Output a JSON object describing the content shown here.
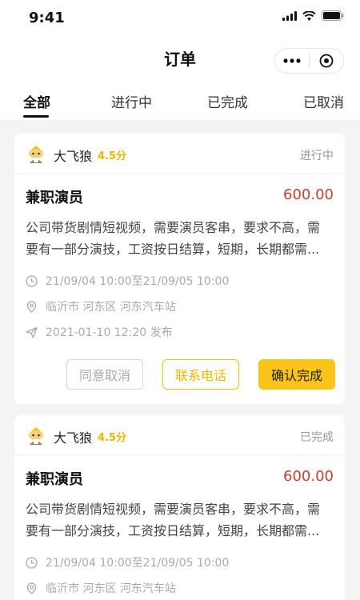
{
  "status_bar": {
    "time": "9:41"
  },
  "nav": {
    "title": "订单"
  },
  "tabs": [
    {
      "label": "全部",
      "active": true
    },
    {
      "label": "进行中",
      "active": false
    },
    {
      "label": "已完成",
      "active": false
    },
    {
      "label": "已取消",
      "active": false
    }
  ],
  "orders": [
    {
      "user": "大飞狼",
      "rating": "4.5分",
      "status": "进行中",
      "title": "兼职演员",
      "price": "600.00",
      "desc_line1": "公司带货剧情短视频，需要演员客串，要求不高，需",
      "desc_line2": "要有一部分演技，工资按日结算，短期，长期都需...",
      "time_range": "21/09/04 10:00至21/09/05 10:00",
      "location": "临沂市 河东区 河东汽车站",
      "published": "2021-01-10 12:20 发布",
      "buttons": {
        "cancel": "同意取消",
        "phone": "联系电话",
        "confirm": "确认完成"
      }
    },
    {
      "user": "大飞狼",
      "rating": "4.5分",
      "status": "已完成",
      "title": "兼职演员",
      "price": "600.00",
      "desc_line1": "公司带货剧情短视频，需要演员客串，要求不高，需",
      "desc_line2": "要有一部分演技，工资按日结算，短期，长期都需...",
      "time_range": "21/09/04 10:00至21/09/05 10:00",
      "location": "临沂市 河东区 河东汽车站"
    }
  ],
  "colors": {
    "accent": "#fcc419",
    "price": "#c8412e",
    "rating": "#f4b400"
  },
  "icons": [
    "signal-icon",
    "wifi-icon",
    "battery-icon",
    "more-icon",
    "target-icon",
    "avatar-icon",
    "clock-icon",
    "location-icon",
    "send-icon"
  ]
}
